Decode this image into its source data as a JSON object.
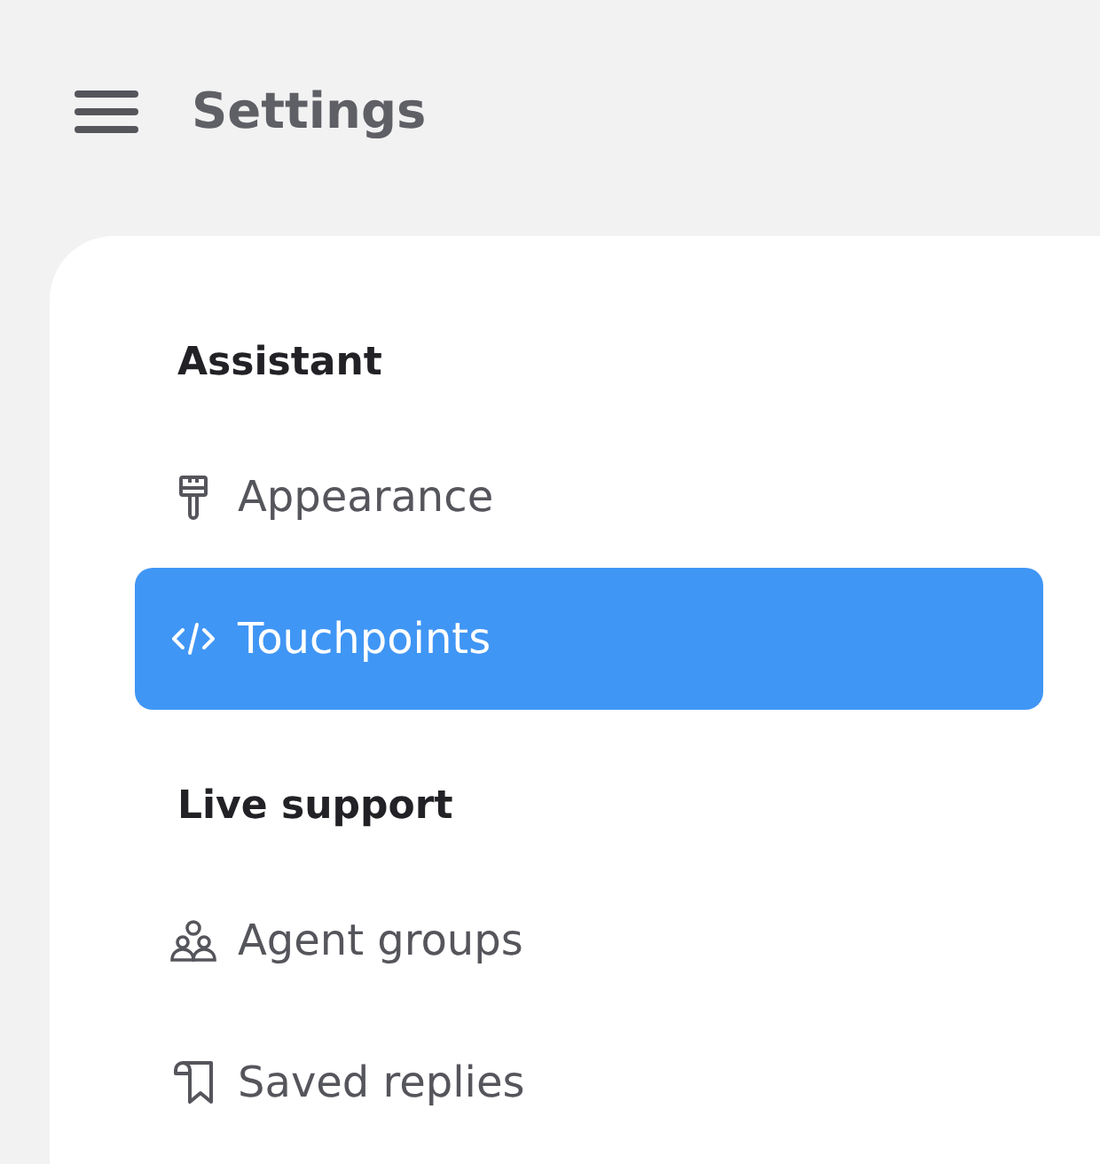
{
  "header": {
    "title": "Settings"
  },
  "sections": [
    {
      "heading": "Assistant",
      "items": [
        {
          "label": "Appearance",
          "kind": "brush",
          "selected": false
        },
        {
          "label": "Touchpoints",
          "kind": "code",
          "selected": true
        }
      ]
    },
    {
      "heading": "Live support",
      "items": [
        {
          "label": "Agent groups",
          "kind": "people",
          "selected": false
        },
        {
          "label": "Saved replies",
          "kind": "bookmark",
          "selected": false
        }
      ]
    }
  ]
}
